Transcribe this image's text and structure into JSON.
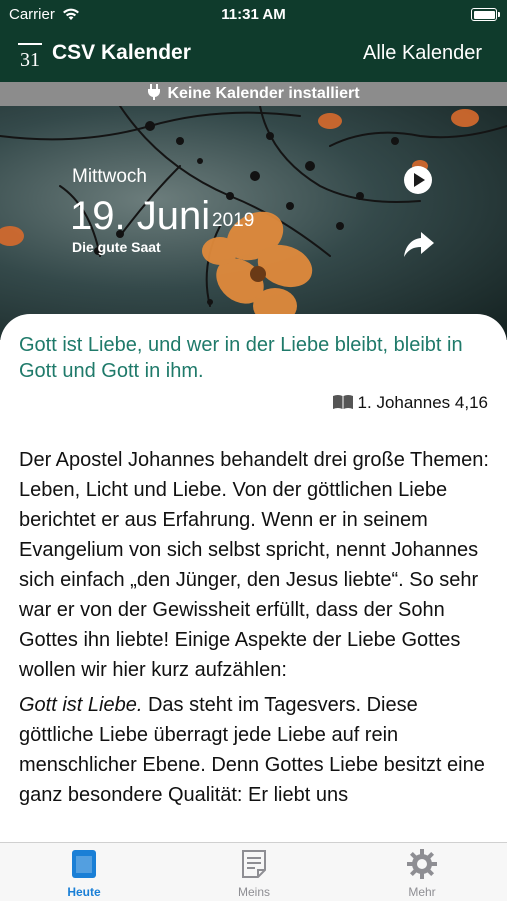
{
  "status_bar": {
    "carrier": "Carrier",
    "time": "11:31 AM",
    "battery_level": 1.0
  },
  "nav": {
    "logo_text": "31",
    "title": "CSV Kalender",
    "right_button": "Alle Kalender"
  },
  "info_banner": {
    "text": "Keine Kalender installiert"
  },
  "hero": {
    "weekday": "Mittwoch",
    "date": "19. Juni",
    "year": "2019",
    "calendar_name": "Die gute Saat"
  },
  "verse": {
    "text": "Gott ist Liebe, und wer in der Liebe bleibt, bleibt in Gott und Gott in ihm.",
    "reference": "1. Johannes 4,16"
  },
  "article": {
    "para1": "Der Apostel Johannes behandelt drei große Themen: Leben, Licht und Liebe. Von der göttlichen Liebe berichtet er aus Erfahrung. Wenn er in seinem Evangelium von sich selbst spricht, nennt Johannes sich einfach „den Jünger, den Jesus liebte“. So sehr war er von der Gewissheit erfüllt, dass der Sohn Gottes ihn liebte! Einige Aspekte der Liebe Gottes wollen wir hier kurz aufzählen:",
    "para2_emph": "Gott ist Liebe.",
    "para2_rest": " Das steht im Tagesvers. Diese göttliche Liebe überragt jede Liebe auf rein menschlicher Ebene. Denn Gottes Liebe besitzt eine ganz besondere Qualität: Er liebt uns"
  },
  "tabs": [
    {
      "label": "Heute",
      "icon": "calendar-page-icon",
      "active": true
    },
    {
      "label": "Meins",
      "icon": "notes-icon",
      "active": false
    },
    {
      "label": "Mehr",
      "icon": "gear-icon",
      "active": false
    }
  ],
  "colors": {
    "nav_bg": "#0f3b2c",
    "verse_text": "#1f7a6a",
    "active_tab": "#1a7fd6",
    "inactive_tab": "#8e8e93",
    "banner_bg": "#8c8c8c"
  }
}
